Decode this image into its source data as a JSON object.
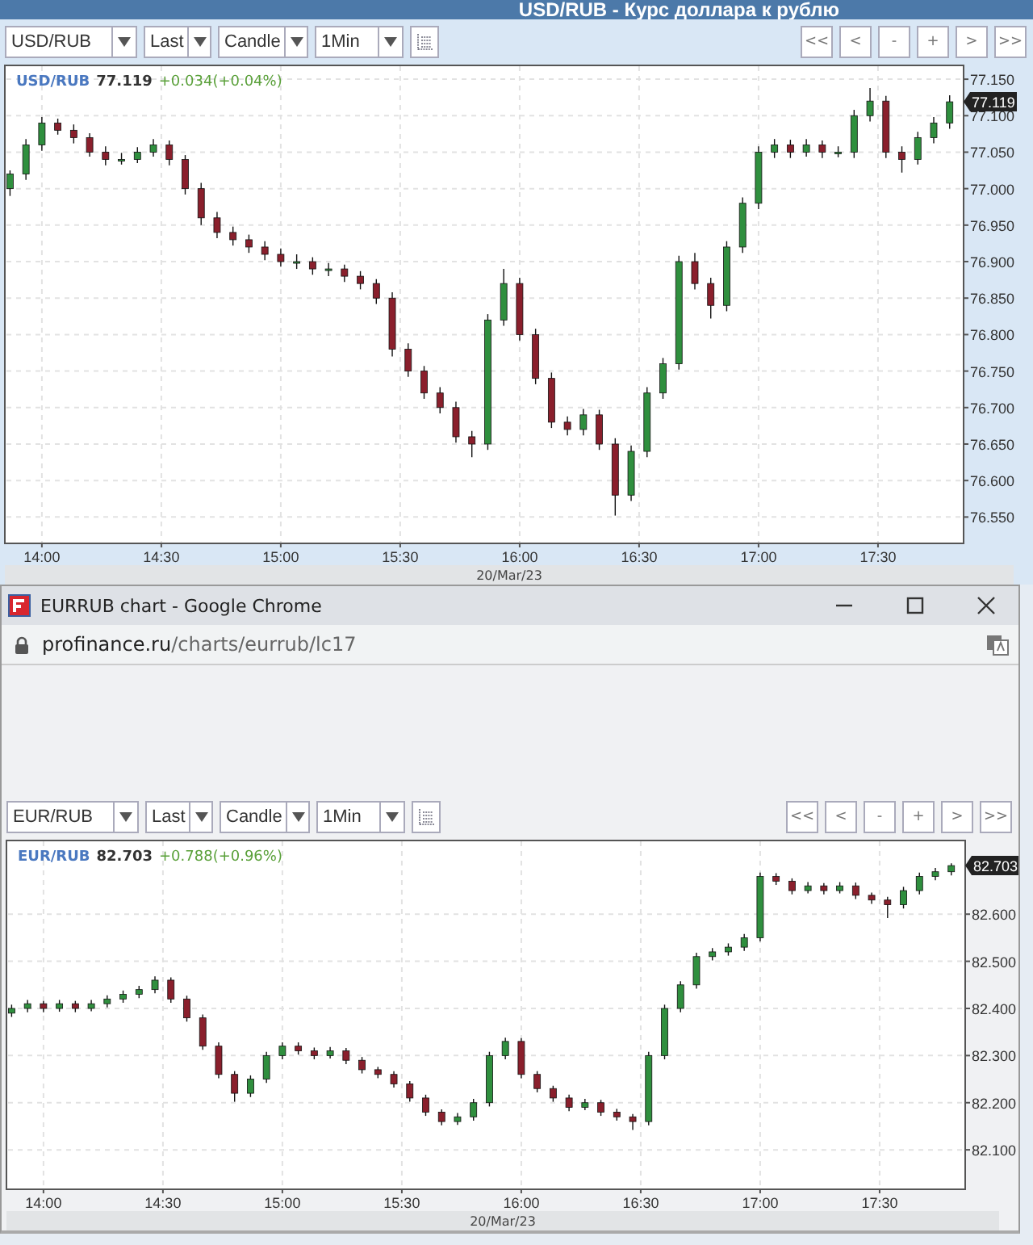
{
  "page_title": "USD/RUB - Курс доллара к рублю",
  "browser_window": {
    "title": "EURRUB chart - Google Chrome",
    "url_host": "profinance.ru",
    "url_path": "/charts/eurrub/lc17"
  },
  "charts": [
    {
      "toolbar": {
        "symbol": "USD/RUB",
        "price_type": "Last",
        "chart_type": "Candle",
        "interval": "1Min"
      },
      "nav_buttons": [
        "<<",
        "<",
        "-",
        "+",
        ">",
        ">>"
      ],
      "legend": {
        "symbol": "USD/RUB",
        "price": "77.119",
        "change": "+0.034(+0.04%)"
      },
      "price_tag": "77.119",
      "date": "20/Mar/23",
      "chart_data": {
        "type": "candlestick",
        "grid": true,
        "xlim": [
          830.7,
          1071.5
        ],
        "ylim": [
          76.515,
          77.17
        ],
        "xticks": [
          {
            "value": 840,
            "label": "14:00"
          },
          {
            "value": 870,
            "label": "14:30"
          },
          {
            "value": 900,
            "label": "15:00"
          },
          {
            "value": 930,
            "label": "15:30"
          },
          {
            "value": 960,
            "label": "16:00"
          },
          {
            "value": 990,
            "label": "16:30"
          },
          {
            "value": 1020,
            "label": "17:00"
          },
          {
            "value": 1050,
            "label": "17:30"
          }
        ],
        "yticks": [
          {
            "value": 77.15,
            "label": "77.150"
          },
          {
            "value": 77.1,
            "label": "77.100"
          },
          {
            "value": 77.05,
            "label": "77.050"
          },
          {
            "value": 77.0,
            "label": "77.000"
          },
          {
            "value": 76.95,
            "label": "76.950"
          },
          {
            "value": 76.9,
            "label": "76.900"
          },
          {
            "value": 76.85,
            "label": "76.850"
          },
          {
            "value": 76.8,
            "label": "76.800"
          },
          {
            "value": 76.75,
            "label": "76.750"
          },
          {
            "value": 76.7,
            "label": "76.700"
          },
          {
            "value": 76.65,
            "label": "76.650"
          },
          {
            "value": 76.6,
            "label": "76.600"
          },
          {
            "value": 76.55,
            "label": "76.550"
          }
        ],
        "x": [
          832,
          836,
          840,
          844,
          848,
          852,
          856,
          860,
          864,
          868,
          872,
          876,
          880,
          884,
          888,
          892,
          896,
          900,
          904,
          908,
          912,
          916,
          920,
          924,
          928,
          932,
          936,
          940,
          944,
          948,
          952,
          956,
          960,
          964,
          968,
          972,
          976,
          980,
          984,
          988,
          992,
          996,
          1000,
          1004,
          1008,
          1012,
          1016,
          1020,
          1024,
          1028,
          1032,
          1036,
          1040,
          1044,
          1048,
          1052,
          1056,
          1060,
          1064,
          1068
        ],
        "ohlc": [
          [
            77.0,
            77.025,
            76.99,
            77.02
          ],
          [
            77.02,
            77.068,
            77.012,
            77.06
          ],
          [
            77.06,
            77.098,
            77.052,
            77.09
          ],
          [
            77.09,
            77.096,
            77.074,
            77.08
          ],
          [
            77.08,
            77.088,
            77.062,
            77.07
          ],
          [
            77.07,
            77.076,
            77.044,
            77.05
          ],
          [
            77.05,
            77.058,
            77.032,
            77.04
          ],
          [
            77.04,
            77.049,
            77.033,
            77.04
          ],
          [
            77.04,
            77.057,
            77.035,
            77.05
          ],
          [
            77.05,
            77.068,
            77.044,
            77.06
          ],
          [
            77.06,
            77.066,
            77.032,
            77.04
          ],
          [
            77.04,
            77.046,
            76.992,
            77.0
          ],
          [
            77.0,
            77.008,
            76.95,
            76.96
          ],
          [
            76.96,
            76.968,
            76.932,
            76.94
          ],
          [
            76.94,
            76.948,
            76.922,
            76.93
          ],
          [
            76.93,
            76.937,
            76.912,
            76.92
          ],
          [
            76.92,
            76.928,
            76.902,
            76.91
          ],
          [
            76.91,
            76.918,
            76.893,
            76.9
          ],
          [
            76.9,
            76.91,
            76.89,
            76.9
          ],
          [
            76.9,
            76.906,
            76.882,
            76.89
          ],
          [
            76.89,
            76.898,
            76.88,
            76.89
          ],
          [
            76.89,
            76.896,
            76.872,
            76.88
          ],
          [
            76.88,
            76.887,
            76.862,
            76.87
          ],
          [
            76.87,
            76.876,
            76.842,
            76.85
          ],
          [
            76.85,
            76.858,
            76.77,
            76.78
          ],
          [
            76.78,
            76.788,
            76.742,
            76.75
          ],
          [
            76.75,
            76.757,
            76.712,
            76.72
          ],
          [
            76.72,
            76.728,
            76.692,
            76.7
          ],
          [
            76.7,
            76.708,
            76.652,
            76.66
          ],
          [
            76.66,
            76.668,
            76.632,
            76.65
          ],
          [
            76.65,
            76.828,
            76.642,
            76.82
          ],
          [
            76.82,
            76.89,
            76.812,
            76.87
          ],
          [
            76.87,
            76.878,
            76.792,
            76.8
          ],
          [
            76.8,
            76.808,
            76.732,
            76.74
          ],
          [
            76.74,
            76.748,
            76.672,
            76.68
          ],
          [
            76.68,
            76.688,
            76.662,
            76.67
          ],
          [
            76.67,
            76.698,
            76.662,
            76.69
          ],
          [
            76.69,
            76.697,
            76.642,
            76.65
          ],
          [
            76.65,
            76.658,
            76.552,
            76.58
          ],
          [
            76.58,
            76.648,
            76.572,
            76.64
          ],
          [
            76.64,
            76.728,
            76.632,
            76.72
          ],
          [
            76.72,
            76.768,
            76.712,
            76.76
          ],
          [
            76.76,
            76.908,
            76.752,
            76.9
          ],
          [
            76.9,
            76.912,
            76.862,
            76.87
          ],
          [
            76.87,
            76.878,
            76.822,
            76.84
          ],
          [
            76.84,
            76.928,
            76.832,
            76.92
          ],
          [
            76.92,
            76.988,
            76.912,
            76.98
          ],
          [
            76.98,
            77.058,
            76.972,
            77.05
          ],
          [
            77.05,
            77.068,
            77.042,
            77.06
          ],
          [
            77.06,
            77.067,
            77.042,
            77.05
          ],
          [
            77.05,
            77.068,
            77.044,
            77.06
          ],
          [
            77.06,
            77.066,
            77.042,
            77.05
          ],
          [
            77.05,
            77.058,
            77.043,
            77.05
          ],
          [
            77.05,
            77.108,
            77.042,
            77.1
          ],
          [
            77.1,
            77.138,
            77.092,
            77.12
          ],
          [
            77.12,
            77.127,
            77.042,
            77.05
          ],
          [
            77.05,
            77.058,
            77.022,
            77.04
          ],
          [
            77.04,
            77.078,
            77.033,
            77.07
          ],
          [
            77.07,
            77.098,
            77.062,
            77.09
          ],
          [
            77.09,
            77.128,
            77.082,
            77.119
          ]
        ]
      }
    },
    {
      "toolbar": {
        "symbol": "EUR/RUB",
        "price_type": "Last",
        "chart_type": "Candle",
        "interval": "1Min"
      },
      "nav_buttons": [
        "<<",
        "<",
        "-",
        "+",
        ">",
        ">>"
      ],
      "legend": {
        "symbol": "EUR/RUB",
        "price": "82.703",
        "change": "+0.788(+0.96%)"
      },
      "price_tag": "82.703",
      "date": "20/Mar/23",
      "chart_data": {
        "type": "candlestick",
        "grid": true,
        "xlim": [
          830.7,
          1071.5
        ],
        "ylim": [
          82.018,
          82.758
        ],
        "xticks": [
          {
            "value": 840,
            "label": "14:00"
          },
          {
            "value": 870,
            "label": "14:30"
          },
          {
            "value": 900,
            "label": "15:00"
          },
          {
            "value": 930,
            "label": "15:30"
          },
          {
            "value": 960,
            "label": "16:00"
          },
          {
            "value": 990,
            "label": "16:30"
          },
          {
            "value": 1020,
            "label": "17:00"
          },
          {
            "value": 1050,
            "label": "17:30"
          }
        ],
        "yticks": [
          {
            "value": 82.6,
            "label": "82.600"
          },
          {
            "value": 82.5,
            "label": "82.500"
          },
          {
            "value": 82.4,
            "label": "82.400"
          },
          {
            "value": 82.3,
            "label": "82.300"
          },
          {
            "value": 82.2,
            "label": "82.200"
          },
          {
            "value": 82.1,
            "label": "82.100"
          }
        ],
        "x": [
          832,
          836,
          840,
          844,
          848,
          852,
          856,
          860,
          864,
          868,
          872,
          876,
          880,
          884,
          888,
          892,
          896,
          900,
          904,
          908,
          912,
          916,
          920,
          924,
          928,
          932,
          936,
          940,
          944,
          948,
          952,
          956,
          960,
          964,
          968,
          972,
          976,
          980,
          984,
          988,
          992,
          996,
          1000,
          1004,
          1008,
          1012,
          1016,
          1020,
          1024,
          1028,
          1032,
          1036,
          1040,
          1044,
          1048,
          1052,
          1056,
          1060,
          1064,
          1068
        ],
        "ohlc": [
          [
            82.39,
            82.408,
            82.382,
            82.4
          ],
          [
            82.4,
            82.418,
            82.392,
            82.41
          ],
          [
            82.41,
            82.416,
            82.392,
            82.4
          ],
          [
            82.4,
            82.418,
            82.393,
            82.41
          ],
          [
            82.41,
            82.416,
            82.392,
            82.4
          ],
          [
            82.4,
            82.418,
            82.394,
            82.41
          ],
          [
            82.41,
            82.428,
            82.402,
            82.42
          ],
          [
            82.42,
            82.438,
            82.412,
            82.43
          ],
          [
            82.43,
            82.448,
            82.422,
            82.44
          ],
          [
            82.44,
            82.468,
            82.432,
            82.46
          ],
          [
            82.46,
            82.466,
            82.412,
            82.42
          ],
          [
            82.42,
            82.427,
            82.372,
            82.38
          ],
          [
            82.38,
            82.387,
            82.312,
            82.32
          ],
          [
            82.32,
            82.328,
            82.252,
            82.26
          ],
          [
            82.26,
            82.267,
            82.202,
            82.22
          ],
          [
            82.22,
            82.258,
            82.212,
            82.25
          ],
          [
            82.25,
            82.308,
            82.242,
            82.3
          ],
          [
            82.3,
            82.328,
            82.292,
            82.32
          ],
          [
            82.32,
            82.328,
            82.302,
            82.31
          ],
          [
            82.31,
            82.317,
            82.292,
            82.3
          ],
          [
            82.3,
            82.318,
            82.294,
            82.31
          ],
          [
            82.31,
            82.316,
            82.282,
            82.29
          ],
          [
            82.29,
            82.297,
            82.262,
            82.27
          ],
          [
            82.27,
            82.276,
            82.252,
            82.26
          ],
          [
            82.26,
            82.267,
            82.232,
            82.24
          ],
          [
            82.24,
            82.246,
            82.202,
            82.21
          ],
          [
            82.21,
            82.217,
            82.172,
            82.18
          ],
          [
            82.18,
            82.186,
            82.152,
            82.16
          ],
          [
            82.16,
            82.178,
            82.153,
            82.17
          ],
          [
            82.17,
            82.208,
            82.162,
            82.2
          ],
          [
            82.2,
            82.308,
            82.192,
            82.3
          ],
          [
            82.3,
            82.338,
            82.292,
            82.33
          ],
          [
            82.33,
            82.337,
            82.252,
            82.26
          ],
          [
            82.26,
            82.267,
            82.222,
            82.23
          ],
          [
            82.23,
            82.236,
            82.202,
            82.21
          ],
          [
            82.21,
            82.217,
            82.182,
            82.19
          ],
          [
            82.19,
            82.208,
            82.184,
            82.2
          ],
          [
            82.2,
            82.206,
            82.172,
            82.18
          ],
          [
            82.18,
            82.187,
            82.162,
            82.17
          ],
          [
            82.17,
            82.176,
            82.142,
            82.16
          ],
          [
            82.16,
            82.308,
            82.152,
            82.3
          ],
          [
            82.3,
            82.408,
            82.292,
            82.4
          ],
          [
            82.4,
            82.458,
            82.392,
            82.45
          ],
          [
            82.45,
            82.518,
            82.442,
            82.51
          ],
          [
            82.51,
            82.528,
            82.502,
            82.52
          ],
          [
            82.52,
            82.538,
            82.512,
            82.53
          ],
          [
            82.53,
            82.558,
            82.522,
            82.55
          ],
          [
            82.55,
            82.688,
            82.542,
            82.68
          ],
          [
            82.68,
            82.687,
            82.662,
            82.67
          ],
          [
            82.67,
            82.676,
            82.642,
            82.65
          ],
          [
            82.65,
            82.668,
            82.644,
            82.66
          ],
          [
            82.66,
            82.666,
            82.642,
            82.65
          ],
          [
            82.65,
            82.668,
            82.644,
            82.66
          ],
          [
            82.66,
            82.667,
            82.632,
            82.64
          ],
          [
            82.64,
            82.646,
            82.622,
            82.63
          ],
          [
            82.63,
            82.637,
            82.592,
            82.62
          ],
          [
            82.62,
            82.658,
            82.612,
            82.65
          ],
          [
            82.65,
            82.688,
            82.642,
            82.68
          ],
          [
            82.68,
            82.698,
            82.672,
            82.69
          ],
          [
            82.69,
            82.708,
            82.682,
            82.703
          ]
        ]
      }
    }
  ]
}
